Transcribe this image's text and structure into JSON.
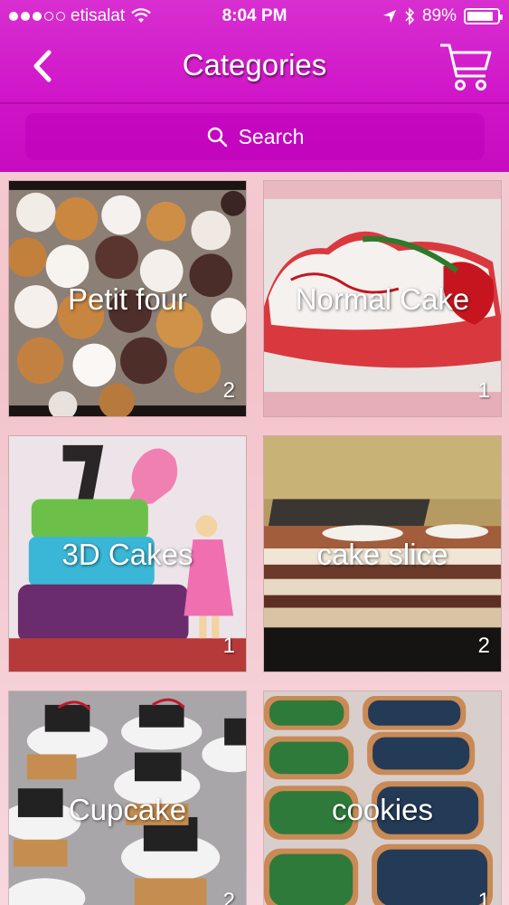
{
  "status": {
    "carrier": "etisalat",
    "time": "8:04 PM",
    "battery": "89%",
    "battery_level": 0.89
  },
  "nav": {
    "title": "Categories",
    "back_icon": "chevron-left-icon",
    "cart_icon": "cart-icon"
  },
  "search": {
    "placeholder": "Search"
  },
  "colors": {
    "header": "#cf14c8",
    "background": "#f3c3cb"
  },
  "categories": [
    {
      "name": "Petit four",
      "count": "2"
    },
    {
      "name": "Normal Cake",
      "count": "1"
    },
    {
      "name": "3D Cakes",
      "count": "1"
    },
    {
      "name": "cake slice",
      "count": "2"
    },
    {
      "name": "Cupcake",
      "count": "2"
    },
    {
      "name": "cookies",
      "count": "1"
    }
  ]
}
